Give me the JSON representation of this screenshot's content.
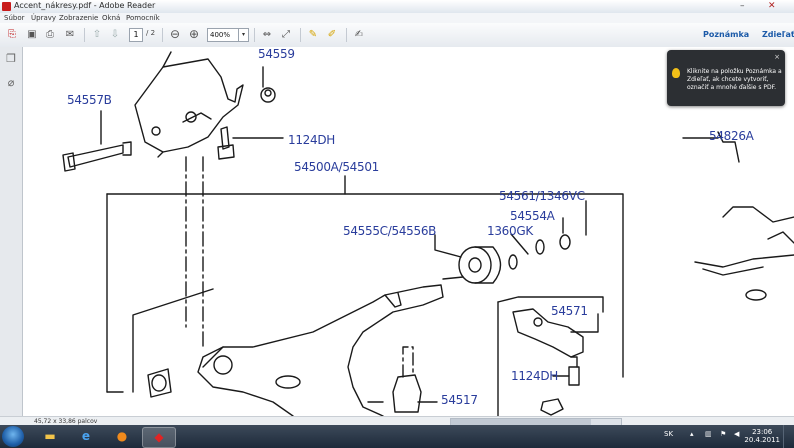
{
  "window": {
    "title": "Accent_nákresy.pdf - Adobe Reader",
    "minimize": "–",
    "close": "✕"
  },
  "menu": [
    "Súbor",
    "Úpravy",
    "Zobrazenie",
    "Okná",
    "Pomocník"
  ],
  "toolbar": {
    "page_current": "1",
    "page_total": "/ 2",
    "zoom": "400%",
    "zoom_dropdown": "▾",
    "notes_label": "Poznámka",
    "share_label": "Zdieľať"
  },
  "tooltip": {
    "text": "Kliknite na položku Poznámka a Zdieľať, ak chcete vytvoriť, označiť a mnohé ďalšie s PDF.",
    "close": "×"
  },
  "diagram": {
    "labels": {
      "p54557B": "54557B",
      "p54559": "54559",
      "p1124DH_top": "1124DH",
      "p54826A": "54826A",
      "p54500A": "54500A/54501",
      "p54561": "54561/1346VC",
      "p54554A": "54554A",
      "p54555C": "54555C/54556B",
      "p1360GK": "1360GK",
      "p54571": "54571",
      "p1124DH_bottom": "1124DH",
      "p54517": "54517"
    }
  },
  "statusbar": {
    "dimensions": "45,72 x 33,86 palcov"
  },
  "taskbar": {
    "lang": "SK",
    "time": "23:06",
    "date": "20.4.2011"
  },
  "icons": {
    "start": "windows-start-icon",
    "explorer": "folder-icon",
    "ie": "internet-explorer-icon",
    "firefox": "firefox-icon",
    "reader": "adobe-reader-icon"
  }
}
